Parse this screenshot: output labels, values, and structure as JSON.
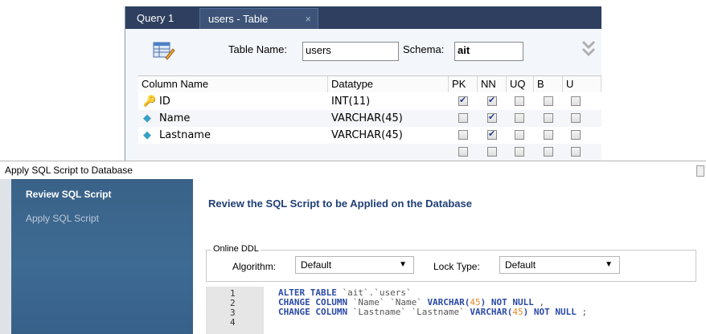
{
  "editor": {
    "tabs": [
      {
        "label": "Query 1"
      },
      {
        "label": "users - Table",
        "close": "×"
      }
    ],
    "table_name_label": "Table Name:",
    "table_name_value": "users",
    "schema_label": "Schema:",
    "schema_value": "ait",
    "columns_header": [
      "Column Name",
      "Datatype",
      "PK",
      "NN",
      "UQ",
      "B",
      "U"
    ],
    "rows": [
      {
        "name": "ID",
        "type": "INT(11)",
        "icon": "key-icon",
        "pk": true,
        "nn": true
      },
      {
        "name": "Name",
        "type": "VARCHAR(45)",
        "icon": "diamond-icon",
        "pk": false,
        "nn": true
      },
      {
        "name": "Lastname",
        "type": "VARCHAR(45)",
        "icon": "diamond-icon",
        "pk": false,
        "nn": true
      },
      {
        "name": "",
        "type": "",
        "icon": "",
        "pk": false,
        "nn": false
      }
    ]
  },
  "dialog": {
    "title": "Apply SQL Script to Database",
    "steps": [
      "Review SQL Script",
      "Apply SQL Script"
    ],
    "heading": "Review the SQL Script to be Applied on the Database",
    "online_ddl_label": "Online DDL",
    "algorithm_label": "Algorithm:",
    "algorithm_value": "Default",
    "lock_type_label": "Lock Type:",
    "lock_type_value": "Default",
    "line_numbers": [
      "1",
      "2",
      "3",
      "4"
    ]
  },
  "colors": {
    "tabbar": "#2e3f5f",
    "sidebar": "#3e6b93",
    "heading": "#1f3f76",
    "keyword": "#2b4aa6",
    "number": "#e08a2a"
  }
}
